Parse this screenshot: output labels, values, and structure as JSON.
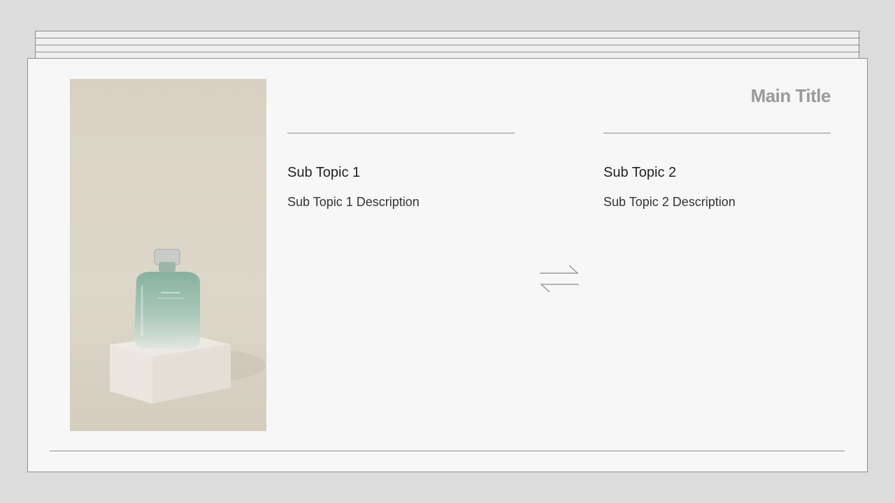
{
  "slide": {
    "main_title": "Main Title",
    "topics": [
      {
        "title": "Sub Topic 1",
        "description": "Sub Topic 1 Description"
      },
      {
        "title": "Sub Topic 2",
        "description": "Sub Topic 2 Description"
      }
    ],
    "swap_icon": "swap-arrows-icon",
    "photo_subject": "perfume-bottle-on-pedestal"
  },
  "colors": {
    "background": "#dcdcdc",
    "slide_background": "#f7f7f7",
    "title_color": "#9a9a9a",
    "line_color": "#8c8c8c",
    "photo_background": "#ddd7c9",
    "bottle_tint": "#8fb5a3"
  }
}
